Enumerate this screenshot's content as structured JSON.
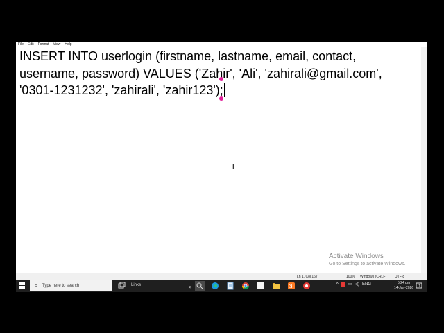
{
  "menu": [
    "File",
    "Edit",
    "Format",
    "View",
    "Help"
  ],
  "editor": {
    "lines": [
      "INSERT INTO userlogin (firstname, lastname, email, contact,",
      "username, password) VALUES ('Zahir', 'Ali', 'zahirali@gmail.com',",
      "'0301-1231232', 'zahirali', 'zahir123');"
    ]
  },
  "status": {
    "position": "Ln 1, Col 167",
    "zoom": "100%",
    "line_ending": "Windows (CRLF)",
    "encoding": "UTF-8"
  },
  "activate": {
    "title": "Activate Windows",
    "subtitle": "Go to Settings to activate Windows."
  },
  "taskbar": {
    "search_placeholder": "Type here to search",
    "links_label": "Links",
    "tray_lang": "ENG",
    "time": "5:24 pm",
    "date": "14-Jan-2026"
  },
  "colors": {
    "selection_handle": "#e0209a",
    "taskbar": "#1f1f1f"
  }
}
